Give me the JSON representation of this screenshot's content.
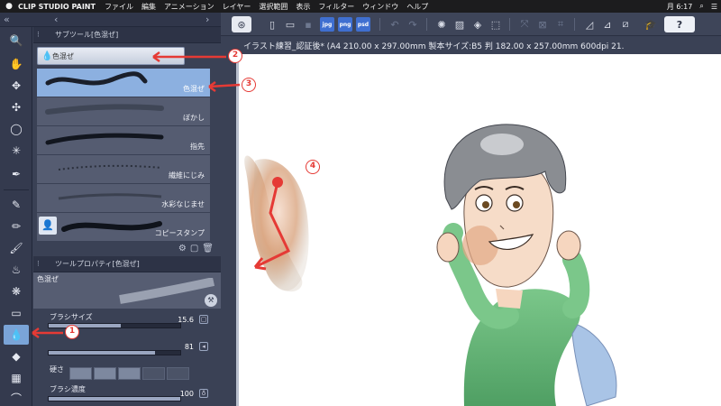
{
  "menubar": {
    "app": "CLIP STUDIO PAINT",
    "items": [
      "ファイル",
      "編集",
      "アニメーション",
      "レイヤー",
      "選択範囲",
      "表示",
      "フィルター",
      "ウィンドウ",
      "ヘルプ"
    ],
    "clock": "月 6:17"
  },
  "subtool_panel": {
    "title": "サブツール[色混ぜ]",
    "group": "色混ぜ",
    "brushes": [
      {
        "label": "色混ぜ",
        "selected": true
      },
      {
        "label": "ぼかし",
        "selected": false
      },
      {
        "label": "指先",
        "selected": false
      },
      {
        "label": "繊維にじみ",
        "selected": false
      },
      {
        "label": "水彩なじませ",
        "selected": false
      },
      {
        "label": "コピースタンプ",
        "selected": false
      }
    ]
  },
  "tool_property": {
    "title": "ツールプロパティ[色混ぜ]",
    "preview_label": "色混ぜ",
    "brush_size": {
      "label": "ブラシサイズ",
      "value": "15.6",
      "fraction": 0.55
    },
    "second": {
      "value": "81",
      "fraction": 0.81
    },
    "hardness": {
      "label": "硬さ"
    },
    "density": {
      "label": "ブラシ濃度",
      "value": "100",
      "fraction": 1.0
    }
  },
  "document_title": "イラスト練習_認証後* (A4 210.00 x 297.00mm 製本サイズ:B5 判 182.00 x 257.00mm 600dpi 21.",
  "toolbar": {
    "badges": [
      "jpg",
      "png",
      "psd"
    ],
    "help": "?"
  },
  "annotations": [
    "1",
    "2",
    "3",
    "4"
  ],
  "colors": {
    "accent_red": "#e53a35",
    "selection_blue": "#8cb0e0",
    "panel": "#3a4155"
  }
}
